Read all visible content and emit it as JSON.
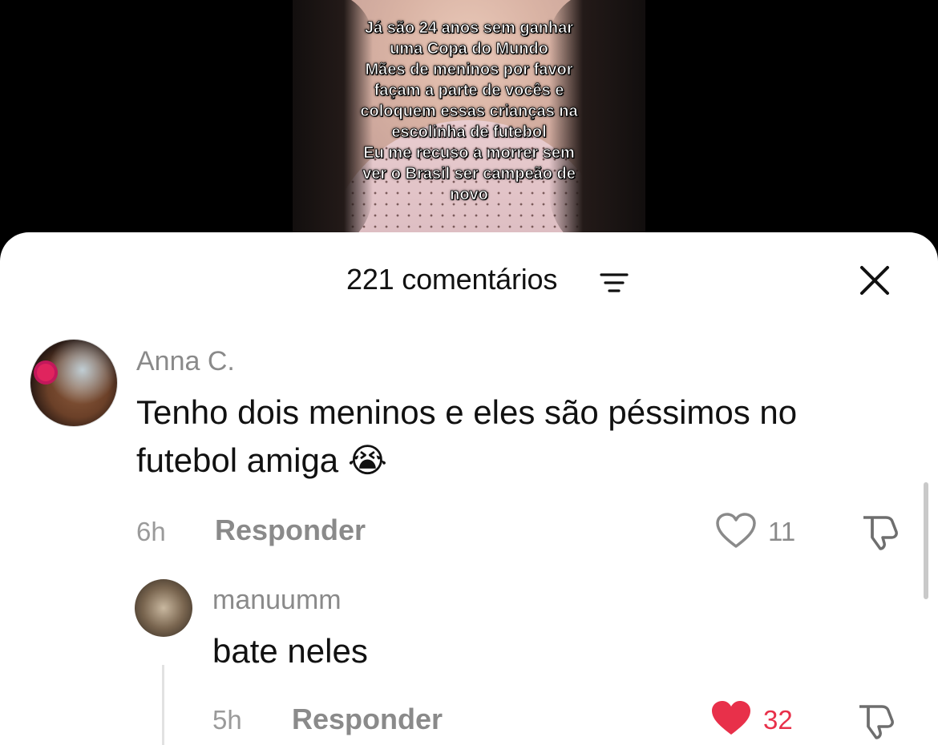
{
  "video": {
    "caption_lines": [
      "Já são 24 anos sem ganhar",
      "uma Copa do Mundo",
      "Mães de meninos por favor",
      "façam a parte de vocês e",
      "coloquem essas crianças na",
      "escolinha de futebol",
      "Eu me recuso a morrer sem",
      "ver o Brasil ser campeão de",
      "novo"
    ]
  },
  "sheet": {
    "title": "221 comentários",
    "sort_icon": "sort-lines-icon",
    "close_icon": "close-x-icon"
  },
  "comments": [
    {
      "username": "Anna C.",
      "text_line1": "Tenho dois meninos e eles são péssimos no",
      "text_line2": "futebol amiga 😭",
      "time": "6h",
      "reply_label": "Responder",
      "likes": "11",
      "liked": false,
      "icons": [
        "heart-outline-icon",
        "dislike-icon"
      ]
    },
    {
      "username": "manuumm",
      "text": "bate neles",
      "time": "5h",
      "reply_label": "Responder",
      "likes": "32",
      "liked": true,
      "icons": [
        "heart-filled-icon",
        "dislike-icon"
      ]
    }
  ],
  "colors": {
    "liked_heart": "#e8304a",
    "secondary_text": "#8a8a8a",
    "primary_text": "#111111"
  }
}
